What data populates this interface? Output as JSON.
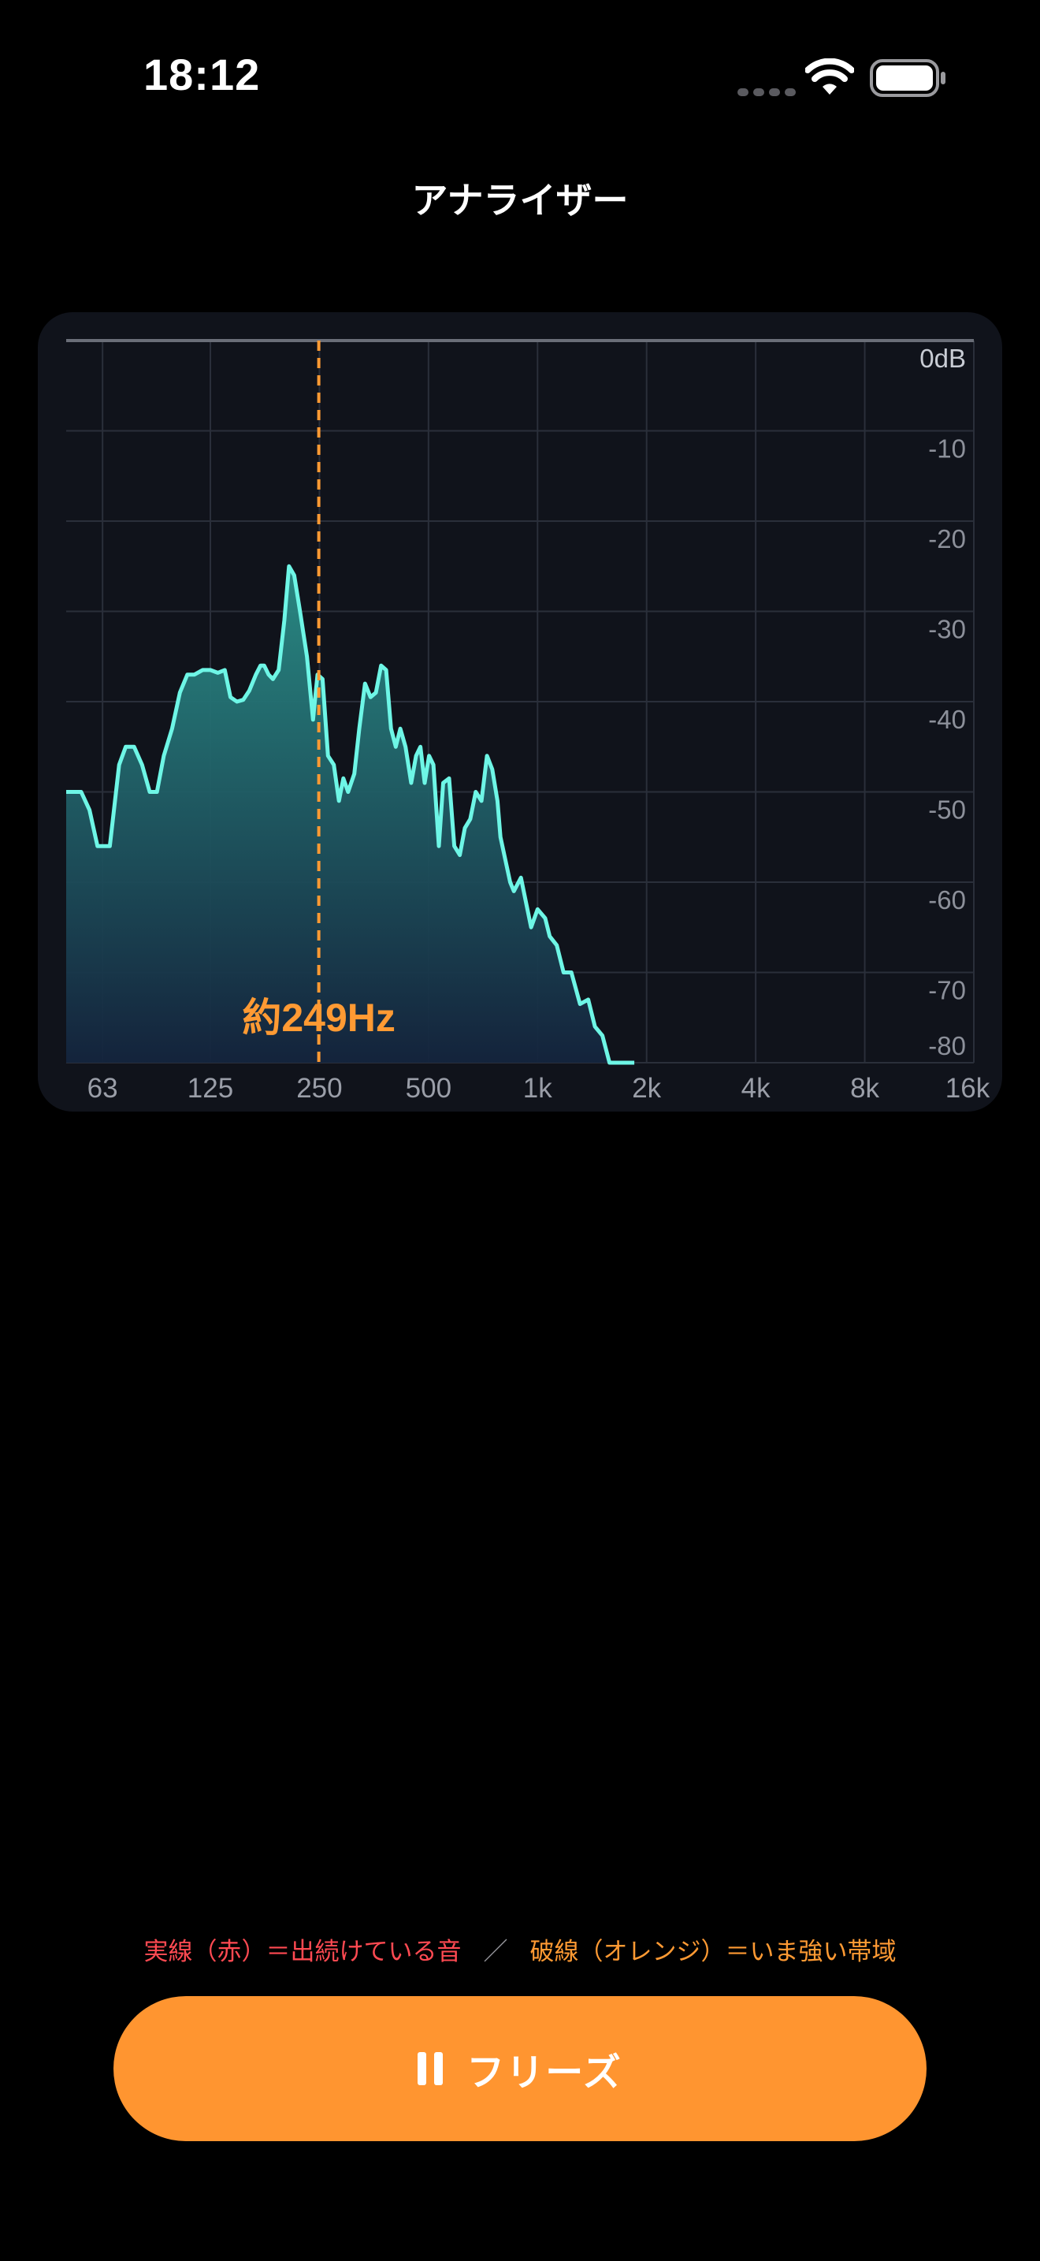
{
  "status_bar": {
    "time": "18:12",
    "icons": [
      "cellular-signal-icon",
      "wifi-icon",
      "battery-icon"
    ]
  },
  "nav": {
    "title": "アナライザー"
  },
  "chart": {
    "peak_marker_label": "約249Hz",
    "colors": {
      "live_line": "#6ef6e6",
      "held_line": "#8a8a8e",
      "marker": "#ff9a33",
      "grid": "#2a2f3a",
      "fill_top": "#2a8f88",
      "fill_bottom": "#14243d"
    }
  },
  "chart_data": {
    "type": "area",
    "xscale": "log",
    "xlim": [
      50,
      16000
    ],
    "ylim": [
      -80,
      0
    ],
    "x_ticks": [
      {
        "value": 63,
        "label": "63"
      },
      {
        "value": 125,
        "label": "125"
      },
      {
        "value": 250,
        "label": "250"
      },
      {
        "value": 500,
        "label": "500"
      },
      {
        "value": 1000,
        "label": "1k"
      },
      {
        "value": 2000,
        "label": "2k"
      },
      {
        "value": 4000,
        "label": "4k"
      },
      {
        "value": 8000,
        "label": "8k"
      },
      {
        "value": 16000,
        "label": "16k"
      }
    ],
    "y_ticks": [
      {
        "value": 0,
        "label": "0dB"
      },
      {
        "value": -10,
        "label": "-10"
      },
      {
        "value": -20,
        "label": "-20"
      },
      {
        "value": -30,
        "label": "-30"
      },
      {
        "value": -40,
        "label": "-40"
      },
      {
        "value": -50,
        "label": "-50"
      },
      {
        "value": -60,
        "label": "-60"
      },
      {
        "value": -70,
        "label": "-70"
      },
      {
        "value": -80,
        "label": "-80"
      }
    ],
    "peak_marker_hz": 249,
    "series": [
      {
        "points": [
          [
            50,
            -50
          ],
          [
            55,
            -50
          ],
          [
            58,
            -52
          ],
          [
            61,
            -56
          ],
          [
            66,
            -56
          ],
          [
            70,
            -47
          ],
          [
            73,
            -45
          ],
          [
            77,
            -45
          ],
          [
            81,
            -47
          ],
          [
            85,
            -50
          ],
          [
            89,
            -50
          ],
          [
            93,
            -46
          ],
          [
            98,
            -43
          ],
          [
            103,
            -39
          ],
          [
            108,
            -37
          ],
          [
            113,
            -37
          ],
          [
            119,
            -36.5
          ],
          [
            125,
            -36.5
          ],
          [
            131,
            -36.8
          ],
          [
            137,
            -36.5
          ],
          [
            142,
            -39.5
          ],
          [
            148,
            -40
          ],
          [
            154,
            -39.8
          ],
          [
            160,
            -38.8
          ],
          [
            167,
            -37
          ],
          [
            172,
            -36
          ],
          [
            176,
            -36
          ],
          [
            181,
            -37
          ],
          [
            186,
            -37.5
          ],
          [
            193,
            -36.5
          ],
          [
            200,
            -31
          ],
          [
            206,
            -25
          ],
          [
            213,
            -26
          ],
          [
            221,
            -30
          ],
          [
            231,
            -35
          ],
          [
            240,
            -42
          ],
          [
            247,
            -37
          ],
          [
            255,
            -37.5
          ],
          [
            264,
            -46
          ],
          [
            274,
            -47
          ],
          [
            283,
            -51
          ],
          [
            291,
            -48.5
          ],
          [
            300,
            -50
          ],
          [
            312,
            -48
          ],
          [
            322,
            -43
          ],
          [
            334,
            -38
          ],
          [
            346,
            -39.5
          ],
          [
            358,
            -39
          ],
          [
            370,
            -36
          ],
          [
            382,
            -36.5
          ],
          [
            394,
            -43
          ],
          [
            406,
            -45
          ],
          [
            418,
            -43
          ],
          [
            432,
            -45
          ],
          [
            448,
            -49
          ],
          [
            462,
            -46
          ],
          [
            475,
            -45
          ],
          [
            488,
            -49
          ],
          [
            502,
            -46
          ],
          [
            516,
            -47
          ],
          [
            534,
            -56
          ],
          [
            549,
            -49
          ],
          [
            570,
            -48.5
          ],
          [
            589,
            -56
          ],
          [
            610,
            -57
          ],
          [
            630,
            -54
          ],
          [
            652,
            -53
          ],
          [
            675,
            -50
          ],
          [
            700,
            -51
          ],
          [
            725,
            -46
          ],
          [
            750,
            -47.5
          ],
          [
            775,
            -51
          ],
          [
            790,
            -55
          ],
          [
            840,
            -60
          ],
          [
            860,
            -61
          ],
          [
            900,
            -59.5
          ],
          [
            960,
            -65
          ],
          [
            1000,
            -63
          ],
          [
            1050,
            -64
          ],
          [
            1080,
            -66
          ],
          [
            1130,
            -67
          ],
          [
            1180,
            -70
          ],
          [
            1240,
            -70
          ],
          [
            1310,
            -73.5
          ],
          [
            1380,
            -73
          ],
          [
            1440,
            -76
          ],
          [
            1510,
            -77
          ],
          [
            1580,
            -80
          ],
          [
            1620,
            -80
          ],
          [
            1680,
            -80
          ],
          [
            1740,
            -80
          ],
          [
            1800,
            -80
          ],
          [
            1850,
            -80
          ]
        ]
      }
    ]
  },
  "legend": {
    "live_text": "実線（赤）＝出続けている音",
    "separator": "／",
    "peak_text": "破線（オレンジ）＝いま強い帯域"
  },
  "freeze_button": {
    "label": "フリーズ"
  }
}
